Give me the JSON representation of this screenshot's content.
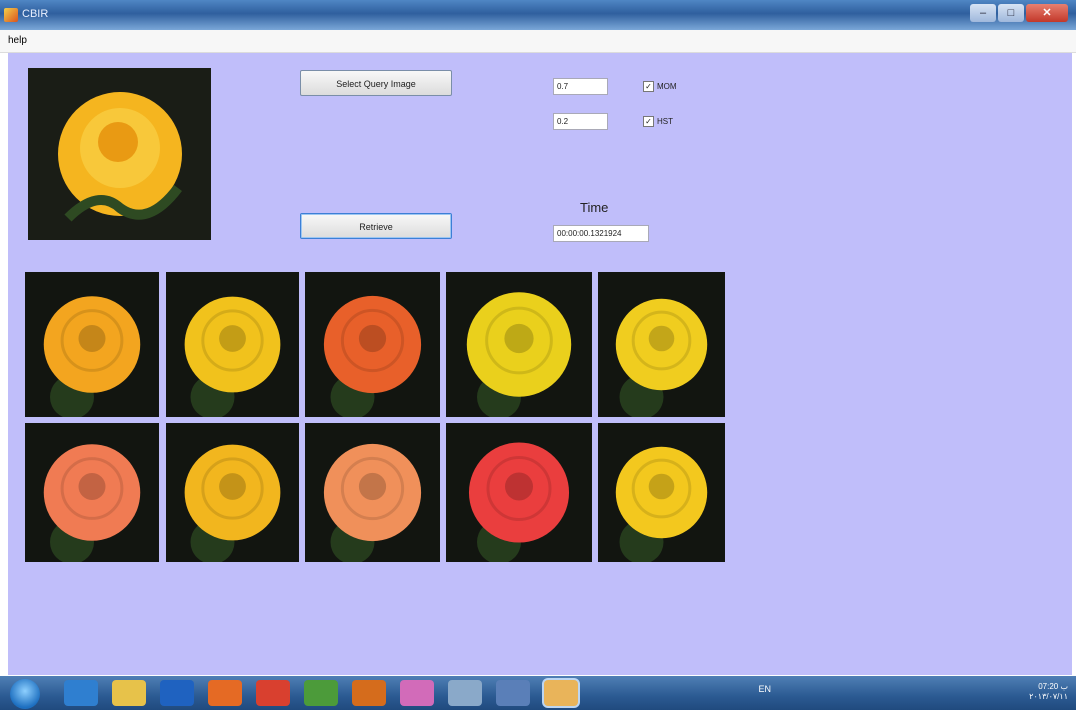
{
  "window": {
    "title": "CBIR"
  },
  "menu": [
    {
      "label": "help"
    }
  ],
  "controls": {
    "select_query_label": "Select Query Image",
    "retrieve_label": "Retrieve",
    "field1_value": "0.7",
    "field2_value": "0.2",
    "check1_label": "MOM",
    "check2_label": "HST",
    "check1_checked": true,
    "check2_checked": true,
    "time_label": "Time",
    "time_value": "00:00:00.1321924"
  },
  "results": [
    {
      "color": "#f3a51f"
    },
    {
      "color": "#f1c21c"
    },
    {
      "color": "#e8602a"
    },
    {
      "color": "#ead01c"
    },
    {
      "color": "#f0cd1f"
    },
    {
      "color": "#f07b53"
    },
    {
      "color": "#f2b61e"
    },
    {
      "color": "#f0905a"
    },
    {
      "color": "#ea3e3e"
    },
    {
      "color": "#f3c81e"
    }
  ],
  "query_image": {
    "color": "#f5b51f"
  },
  "taskbar": {
    "icons": [
      "start-icon",
      "ie-icon",
      "explorer-icon",
      "matlab-icon",
      "media-player-icon",
      "chrome-icon",
      "network-icon",
      "firefox-icon",
      "paint-icon",
      "calculator-icon",
      "vs-icon",
      "cbir-app-icon"
    ],
    "tray_language": "EN",
    "clock_time": "07:20 ب",
    "clock_date": "٢٠١٣/٠٧/١١"
  }
}
